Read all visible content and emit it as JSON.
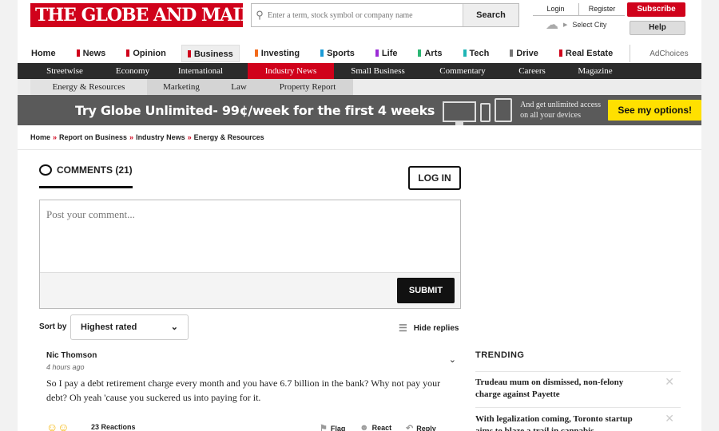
{
  "header": {
    "logo_text": "THE GLOBE AND MAIL",
    "search_placeholder": "Enter a term, stock symbol or company name",
    "search_button": "Search",
    "login": "Login",
    "register": "Register",
    "city": "Select City",
    "subscribe": "Subscribe",
    "help": "Help"
  },
  "main_nav": {
    "items": [
      {
        "label": "Home",
        "color": ""
      },
      {
        "label": "News",
        "color": "#d0021b"
      },
      {
        "label": "Opinion",
        "color": "#d0021b"
      },
      {
        "label": "Business",
        "color": "#d0021b",
        "active": true
      },
      {
        "label": "Investing",
        "color": "#f26a1b"
      },
      {
        "label": "Sports",
        "color": "#1a9bd7"
      },
      {
        "label": "Life",
        "color": "#9b2bd6"
      },
      {
        "label": "Arts",
        "color": "#2bb673"
      },
      {
        "label": "Tech",
        "color": "#1fb5b5"
      },
      {
        "label": "Drive",
        "color": "#777777"
      },
      {
        "label": "Real Estate",
        "color": "#d0021b"
      }
    ],
    "adchoices": "AdChoices"
  },
  "section_nav": {
    "items": [
      "Streetwise",
      "Economy",
      "International",
      "Industry News",
      "Small Business",
      "Commentary",
      "Careers",
      "Magazine"
    ],
    "active": "Industry News"
  },
  "sub_nav": {
    "items": [
      "Energy & Resources",
      "Marketing",
      "Law",
      "Property Report"
    ],
    "active": "Energy & Resources"
  },
  "promo": {
    "title": "Try Globe Unlimited- 99¢/week for the first 4 weeks",
    "desc": "And get unlimited access on all your devices",
    "cta": "See my options!"
  },
  "breadcrumb": [
    "Home",
    "Report on Business",
    "Industry News",
    "Energy & Resources"
  ],
  "comments": {
    "header": "COMMENTS (21)",
    "login": "LOG IN",
    "placeholder": "Post your comment...",
    "submit": "SUBMIT",
    "sort_label": "Sort by",
    "sort_value": "Highest rated",
    "hide_replies": "Hide replies",
    "items": [
      {
        "author": "Nic Thomson",
        "time": "4 hours ago",
        "text": "So I pay a debt retirement charge every month and you have 6.7 billion in the bank? Why not pay your debt? Oh yeah 'cause you suckered us into paying for it.",
        "reactions": "23 Reactions",
        "flag": "Flag",
        "react": "React",
        "reply": "Reply"
      }
    ]
  },
  "trending": {
    "title": "TRENDING",
    "items": [
      "Trudeau mum on dismissed, non-felony charge against Payette",
      "With legalization coming, Toronto startup aims to blaze a trail in cannabis"
    ]
  },
  "icons": {
    "search": "magnifier-icon",
    "weather": "cloud-icon",
    "comments": "speech-bubble-icon",
    "chevron": "chevron-down-icon",
    "hide": "list-indent-icon",
    "flag": "flag-icon",
    "react": "smiley-icon",
    "reply": "reply-arrow-icon",
    "close": "close-icon"
  }
}
